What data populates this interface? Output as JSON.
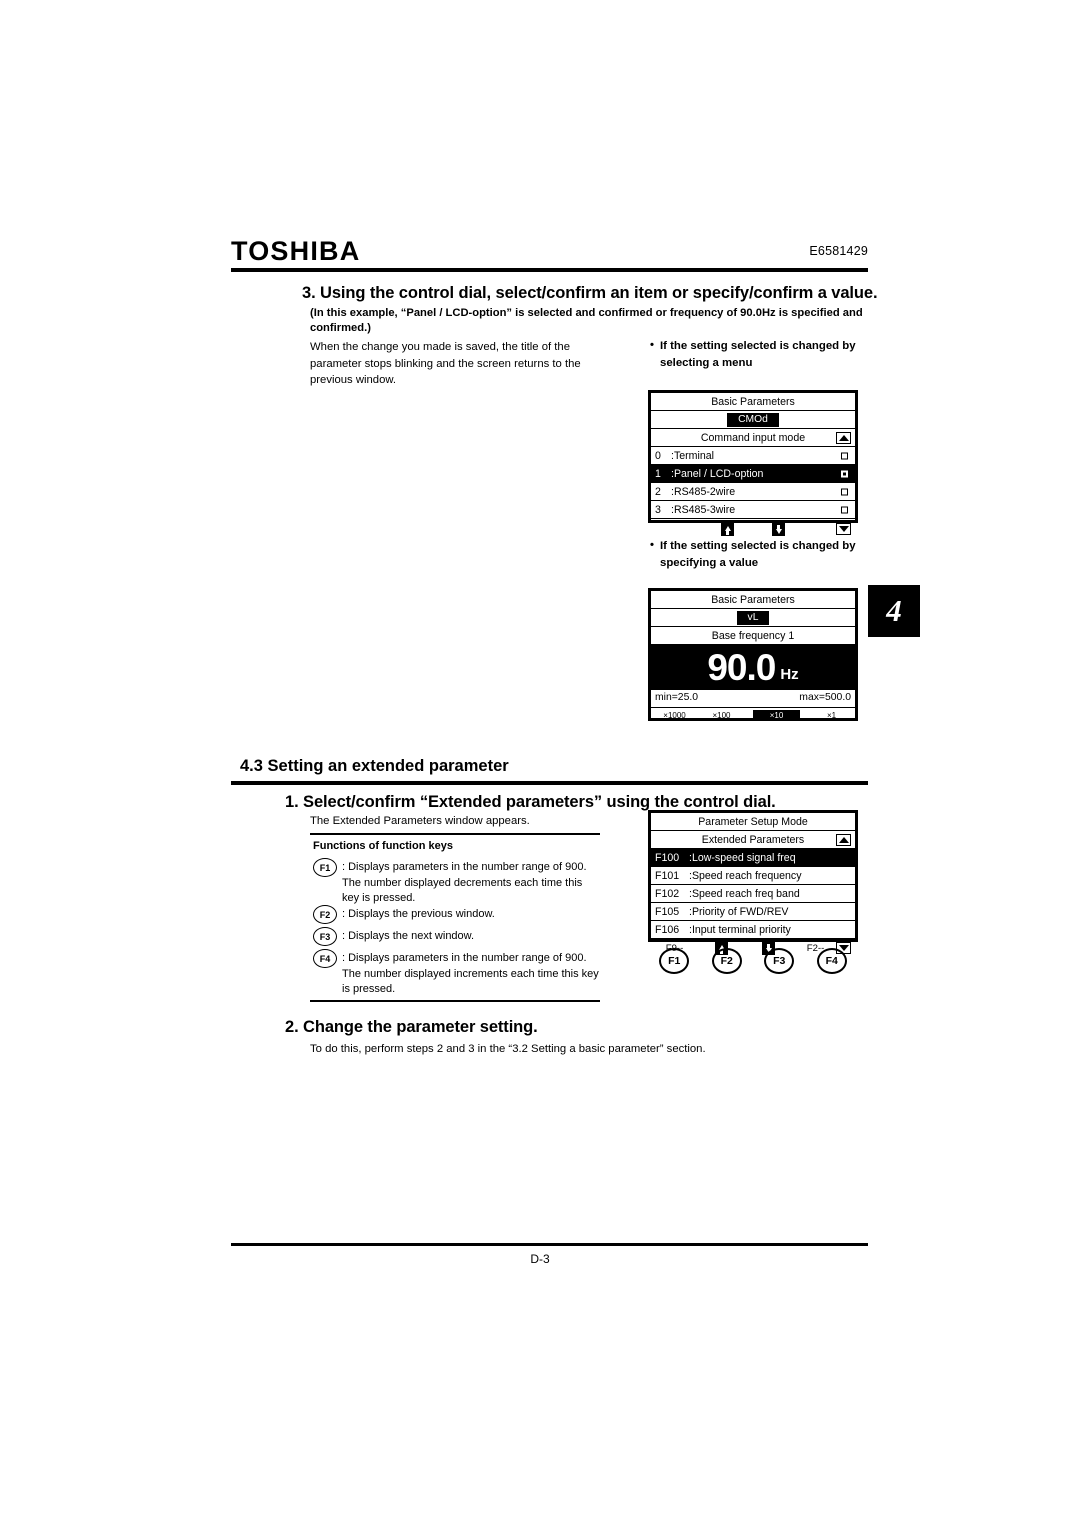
{
  "header": {
    "logo": "TOSHIBA",
    "doc_code": "E6581429"
  },
  "chapter_tab": "4",
  "step3": {
    "heading": "3. Using the control dial, select/confirm an item or specify/confirm a value.",
    "note_line1": "(In this example, “Panel / LCD-option” is selected and confirmed or frequency of 90.0Hz is specified and",
    "note_line2": "confirmed.)",
    "body": "When the change you made is saved, the title of the parameter stops blinking and the screen returns to the previous window."
  },
  "bullets": {
    "menu": "If the setting selected is changed by selecting a menu",
    "value": "If the setting selected is changed by specifying a value",
    "dot": "•"
  },
  "panel_menu": {
    "title": "Basic Parameters",
    "tag": "CMOd",
    "subtitle": "Command input mode",
    "options": [
      {
        "num": "0",
        "label": ":Terminal",
        "selected": false
      },
      {
        "num": "1",
        "label": ":Panel / LCD-option",
        "selected": true
      },
      {
        "num": "2",
        "label": ":RS485-2wire",
        "selected": false
      },
      {
        "num": "3",
        "label": ":RS485-3wire",
        "selected": false
      }
    ]
  },
  "panel_value": {
    "title": "Basic Parameters",
    "tag": "vL",
    "subtitle": "Base frequency 1",
    "value": "90.0",
    "unit": "Hz",
    "min": "min=25.0",
    "max": "max=500.0",
    "multipliers": [
      {
        "label": "×1000",
        "active": false
      },
      {
        "label": "×100",
        "active": false
      },
      {
        "label": "×10",
        "active": true
      },
      {
        "label": "×1",
        "active": false
      }
    ]
  },
  "section43": {
    "title": "4.3 Setting an extended parameter",
    "step1_heading": "1. Select/confirm “Extended parameters” using the control dial.",
    "step1_body": "The Extended Parameters window appears.",
    "step2_heading": "2. Change the parameter setting.",
    "step2_body": "To do this, perform steps 2 and 3 in the “3.2 Setting a basic parameter” section."
  },
  "panel_extended": {
    "title": "Parameter Setup Mode",
    "subtitle": "Extended Parameters",
    "rows": [
      {
        "code": "F100",
        "label": ":Low-speed signal freq",
        "selected": true
      },
      {
        "code": "F101",
        "label": ":Speed reach frequency",
        "selected": false
      },
      {
        "code": "F102",
        "label": ":Speed reach freq band",
        "selected": false
      },
      {
        "code": "F105",
        "label": ":Priority of FWD/REV",
        "selected": false
      },
      {
        "code": "F106",
        "label": ":Input terminal priority",
        "selected": false
      }
    ],
    "footer_left": "F9--",
    "footer_right": "F2--"
  },
  "function_keys": [
    "F1",
    "F2",
    "F3",
    "F4"
  ],
  "legend": {
    "title": "Functions of function keys",
    "items": [
      {
        "key": "F1",
        "text": ": Displays parameters in the number range of 900. The number displayed decrements each time this key is pressed."
      },
      {
        "key": "F2",
        "text": ": Displays the previous window."
      },
      {
        "key": "F3",
        "text": ": Displays the next window."
      },
      {
        "key": "F4",
        "text": ": Displays parameters in the number range of 900. The number displayed increments each time this key is pressed."
      }
    ]
  },
  "footer": {
    "page_number": "D-3"
  }
}
